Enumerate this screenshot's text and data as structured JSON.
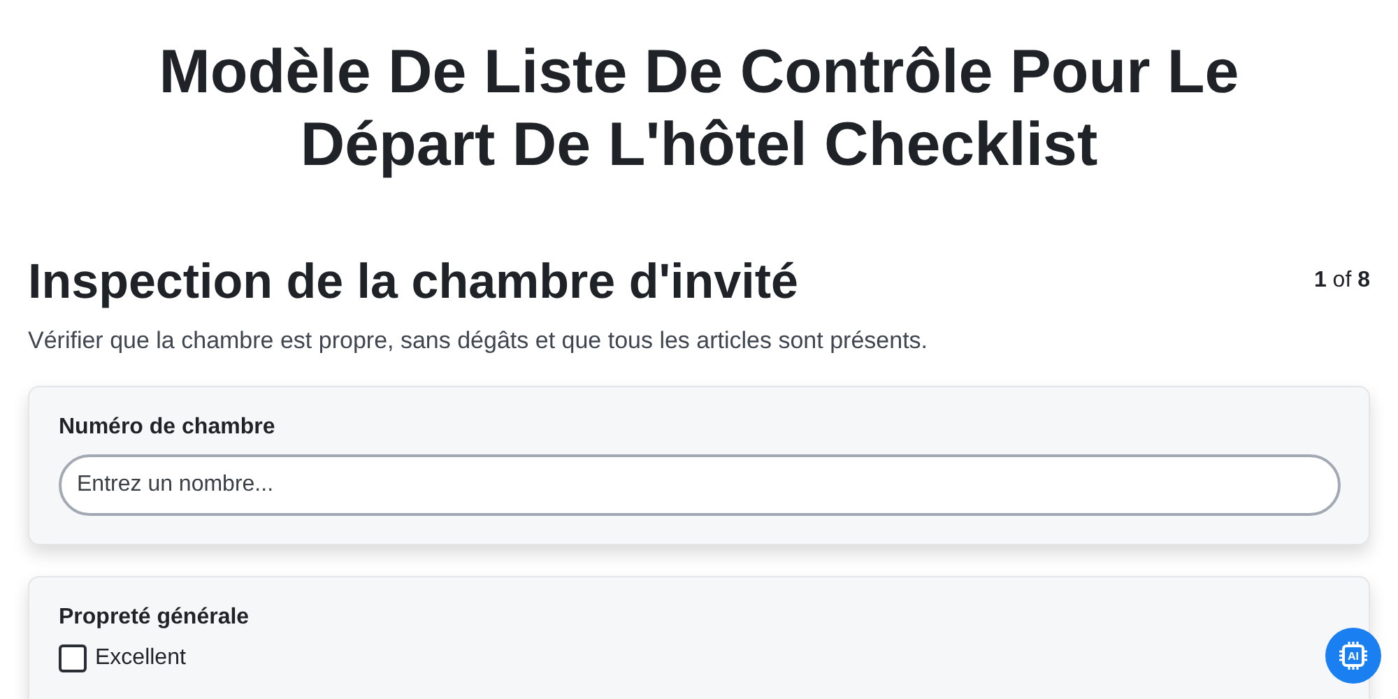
{
  "title": "Modèle De Liste De Contrôle Pour Le Départ De L'hôtel Checklist",
  "section": {
    "heading": "Inspection de la chambre d'invité",
    "counter": "**1** of **8**",
    "description": "Vérifier que la chambre est propre, sans dégâts et que tous les articles sont présents."
  },
  "questions": [
    {
      "kind": "text",
      "label": "Numéro de chambre",
      "placeholder": "Entrez un nombre..."
    },
    {
      "kind": "checkboxes",
      "label": "Propreté générale",
      "options": [
        {
          "label": "Excellent",
          "checked": false
        }
      ]
    }
  ],
  "assistant_button": {
    "label": "AI"
  }
}
